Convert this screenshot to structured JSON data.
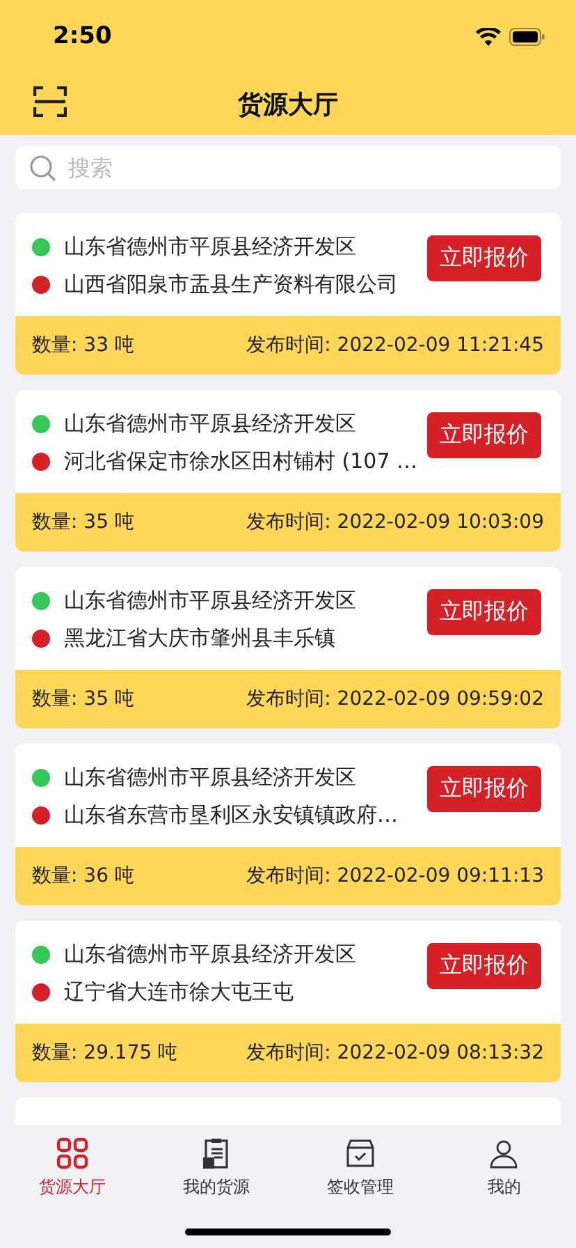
{
  "status_bar": {
    "time": "2:50"
  },
  "header": {
    "title": "货源大厅"
  },
  "search": {
    "placeholder": "搜索"
  },
  "orders": [
    {
      "origin": "山东省德州市平原县经济开发区",
      "destination": "山西省阳泉市盂县生产资料有限公司",
      "button": "立即报价",
      "quantity": "数量: 33 吨",
      "published": "发布时间: 2022-02-09 11:21:45"
    },
    {
      "origin": "山东省德州市平原县经济开发区",
      "destination": "河北省保定市徐水区田村铺村 (107 …",
      "button": "立即报价",
      "quantity": "数量: 35 吨",
      "published": "发布时间: 2022-02-09 10:03:09"
    },
    {
      "origin": "山东省德州市平原县经济开发区",
      "destination": "黑龙江省大庆市肇州县丰乐镇",
      "button": "立即报价",
      "quantity": "数量: 35 吨",
      "published": "发布时间: 2022-02-09 09:59:02"
    },
    {
      "origin": "山东省德州市平原县经济开发区",
      "destination": "山东省东营市垦利区永安镇镇政府…",
      "button": "立即报价",
      "quantity": "数量: 36 吨",
      "published": "发布时间: 2022-02-09 09:11:13"
    },
    {
      "origin": "山东省德州市平原县经济开发区",
      "destination": "辽宁省大连市徐大屯王屯",
      "button": "立即报价",
      "quantity": "数量: 29.175 吨",
      "published": "发布时间: 2022-02-09 08:13:32"
    }
  ],
  "tabs": [
    {
      "label": "货源大厅",
      "selected": true,
      "kind": "grid"
    },
    {
      "label": "我的货源",
      "selected": false,
      "kind": "clipboard"
    },
    {
      "label": "签收管理",
      "selected": false,
      "kind": "box"
    },
    {
      "label": "我的",
      "selected": false,
      "kind": "person"
    }
  ]
}
